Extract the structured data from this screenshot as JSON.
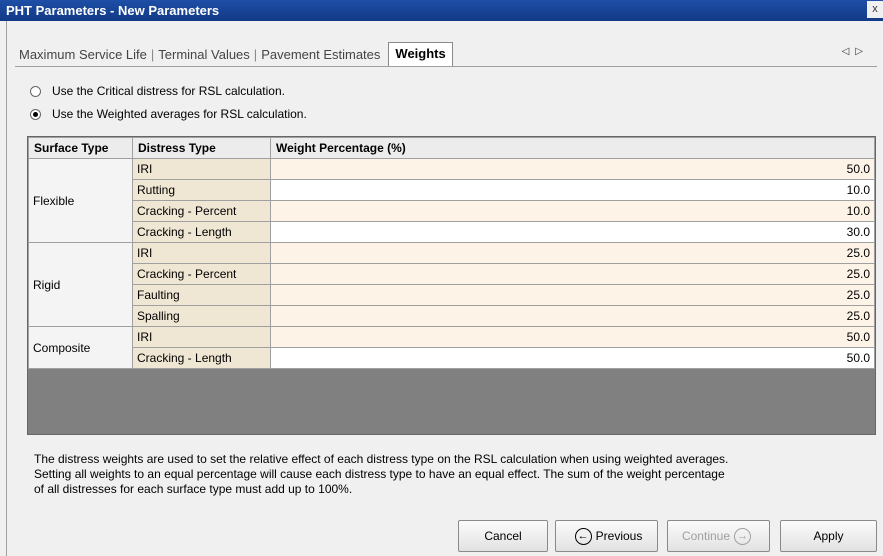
{
  "window": {
    "title": "PHT Parameters - New Parameters",
    "close": "x"
  },
  "tabs": [
    {
      "label": "Maximum Service Life"
    },
    {
      "label": "Terminal Values"
    },
    {
      "label": "Pavement Estimates"
    },
    {
      "label": "Weights",
      "active": true
    }
  ],
  "tab_nav": {
    "prev": "◁",
    "next": "▷"
  },
  "options": [
    {
      "label": "Use the Critical distress for RSL calculation.",
      "selected": false
    },
    {
      "label": "Use the Weighted averages for RSL calculation.",
      "selected": true
    }
  ],
  "table": {
    "headers": [
      "Surface Type",
      "Distress Type",
      "Weight Percentage  (%)"
    ],
    "groups": [
      {
        "surface": "Flexible",
        "rows": [
          {
            "distress": "IRI",
            "weight": "50.0"
          },
          {
            "distress": "Rutting",
            "weight": "10.0"
          },
          {
            "distress": "Cracking - Percent",
            "weight": "10.0"
          },
          {
            "distress": "Cracking - Length",
            "weight": "30.0"
          }
        ]
      },
      {
        "surface": "Rigid",
        "rows": [
          {
            "distress": "IRI",
            "weight": "25.0"
          },
          {
            "distress": "Cracking - Percent",
            "weight": "25.0"
          },
          {
            "distress": "Faulting",
            "weight": "25.0"
          },
          {
            "distress": "Spalling",
            "weight": "25.0"
          }
        ]
      },
      {
        "surface": "Composite",
        "rows": [
          {
            "distress": "IRI",
            "weight": "50.0"
          },
          {
            "distress": "Cracking - Length",
            "weight": "50.0"
          }
        ]
      }
    ]
  },
  "note": {
    "line1": "The distress weights are used to set the relative effect of each distress type on the RSL calculation when using weighted averages.",
    "line2": "Setting all weights to an equal percentage will cause each distress type to have an equal effect. The sum of the weight percentage",
    "line3": "of all distresses for each surface type must add up to 100%."
  },
  "buttons": {
    "cancel": "Cancel",
    "previous": "Previous",
    "continue": "Continue",
    "apply": "Apply"
  },
  "colors": {
    "titlebar": "#1e4fa6",
    "distress_cell": "#f0e6d4",
    "grid_empty": "#808080"
  }
}
